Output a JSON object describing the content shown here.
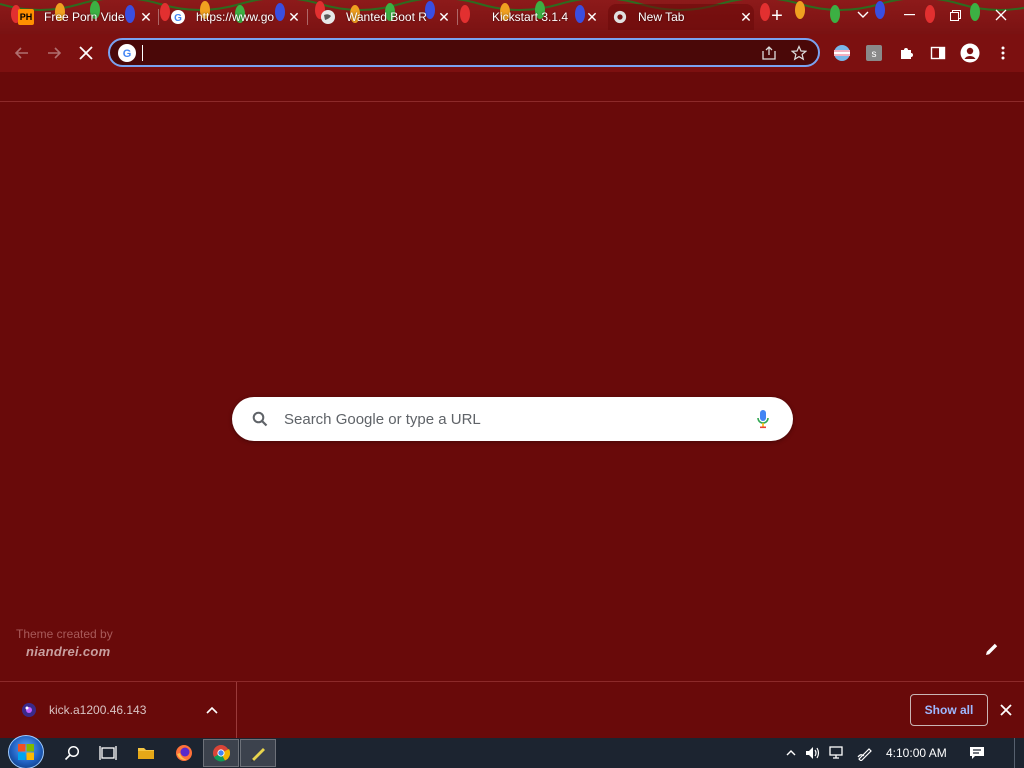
{
  "tabs": [
    {
      "title": "Free Porn Vide",
      "favicon": "pornhub-favicon",
      "active": false
    },
    {
      "title": "https://www.go",
      "favicon": "google-favicon",
      "active": false
    },
    {
      "title": "Wanted Boot R",
      "favicon": "globe-favicon",
      "active": false
    },
    {
      "title": "Kickstart 3.1.4",
      "favicon": "none",
      "active": false
    },
    {
      "title": "New Tab",
      "favicon": "chrome-favicon",
      "active": true
    }
  ],
  "tab_favicon_text": {
    "ph": "PH"
  },
  "omnibox": {
    "value": "",
    "placeholder": ""
  },
  "ntp": {
    "search_placeholder": "Search Google or type a URL",
    "theme_credit_line1": "Theme created by",
    "theme_credit_line2": "niandrei.com"
  },
  "downloads": {
    "item_name": "kick.a1200.46.143",
    "show_all_label": "Show all"
  },
  "taskbar": {
    "time": "4:10:00 AM"
  },
  "colors": {
    "theme_background": "#690a0a",
    "toolbar": "#7c1010",
    "omnibox_focus_border": "#7aa2f0",
    "show_all_text": "#9db8ff"
  }
}
